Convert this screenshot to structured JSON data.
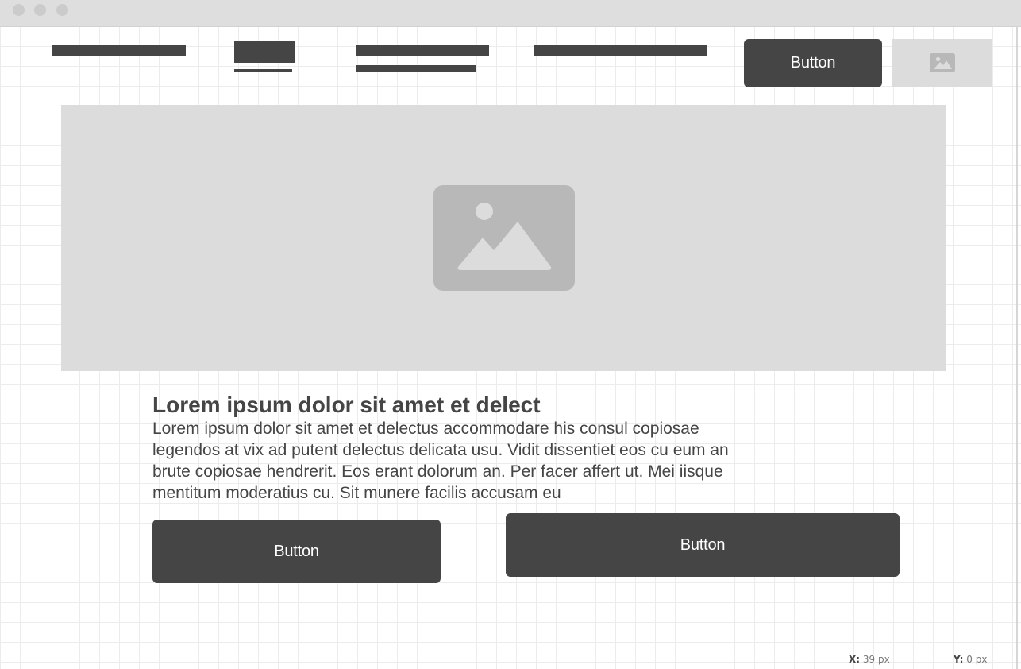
{
  "window": {
    "controls": [
      "close",
      "minimize",
      "maximize"
    ]
  },
  "nav": {
    "items": [
      {
        "kind": "placeholder-line"
      },
      {
        "kind": "placeholder-block-underlined",
        "state": "active"
      },
      {
        "kind": "placeholder-two-lines"
      },
      {
        "kind": "placeholder-line"
      }
    ],
    "button_label": "Button",
    "image_icon": "image-icon"
  },
  "hero": {
    "image_icon": "image-icon"
  },
  "content": {
    "heading": "Lorem ipsum dolor sit amet et delect",
    "paragraph": "Lorem ipsum dolor sit amet et delectus accommodare his consul copiosae legendos at vix ad putent delectus delicata usu. Vidit dissentiet eos cu eum an brute copiosae hendrerit. Eos erant dolorum an. Per facer affert ut. Mei iisque mentitum moderatius cu. Sit munere facilis accusam eu"
  },
  "actions": {
    "primary_label": "Button",
    "secondary_label": "Button"
  },
  "status": {
    "x_label": "X:",
    "x_value": "39 px",
    "y_label": "Y:",
    "y_value": "0 px"
  },
  "colors": {
    "dark": "#454545",
    "placeholder": "#dcdcdc",
    "icon": "#b8b8b8",
    "grid": "#ececec"
  }
}
